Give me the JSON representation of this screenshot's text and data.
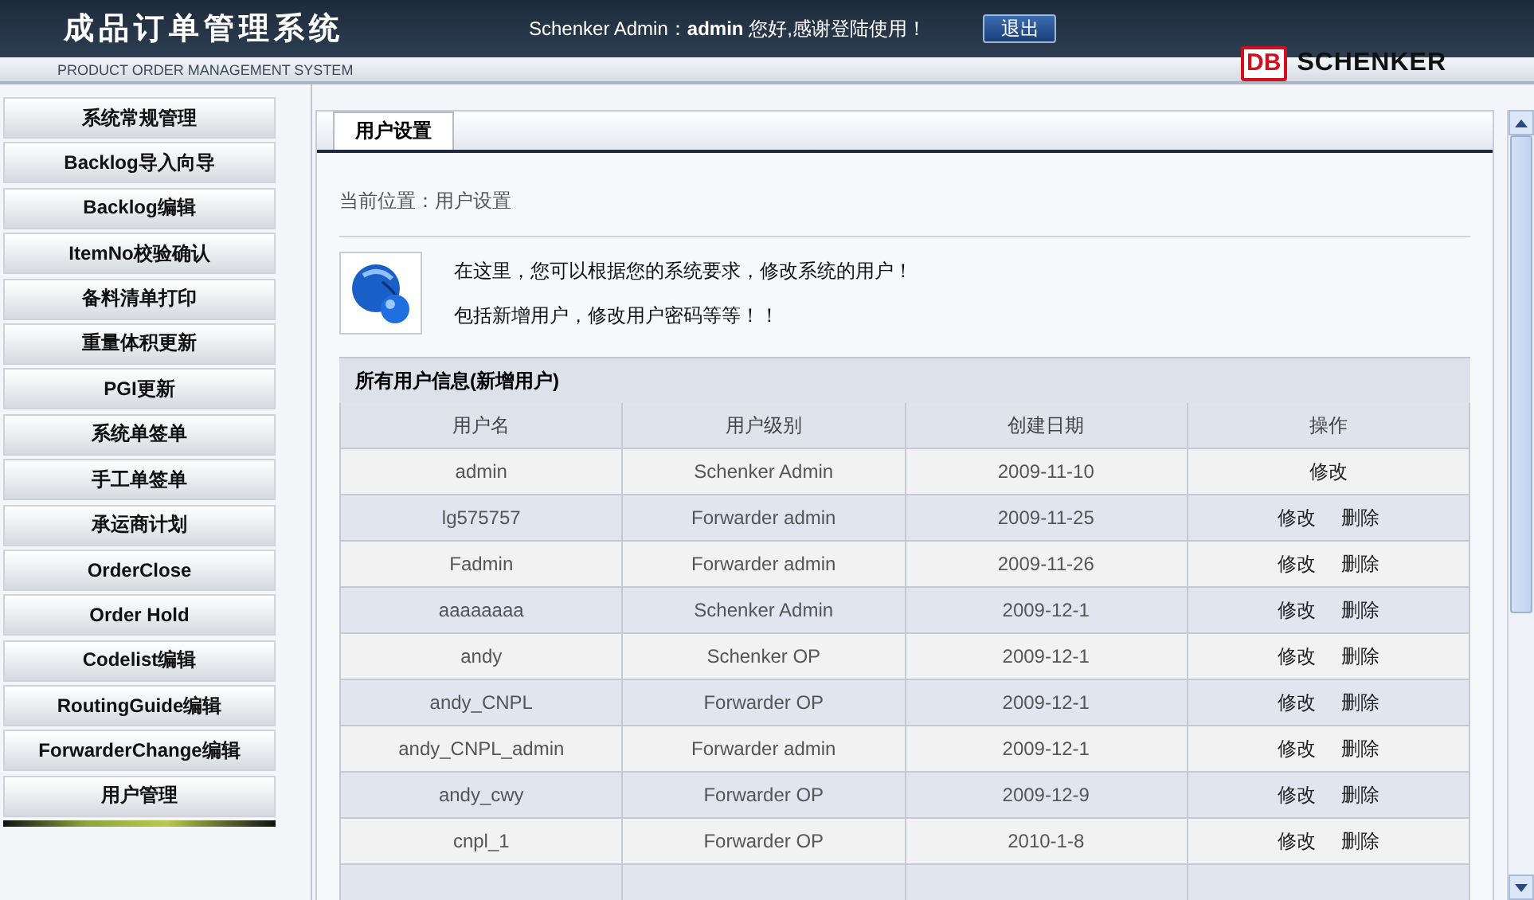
{
  "header": {
    "title": "成品订单管理系统",
    "subtitle": "PRODUCT ORDER MANAGEMENT SYSTEM",
    "greeting": "Schenker Admin：**admin** 您好,感谢登陆使用！",
    "logout": "退出",
    "logo_mark": "DB",
    "logo_text": "SCHENKER"
  },
  "sidebar": {
    "items": [
      {
        "label": "系统常规管理"
      },
      {
        "label": "Backlog导入向导"
      },
      {
        "label": "Backlog编辑"
      },
      {
        "label": "ItemNo校验确认"
      },
      {
        "label": "备料清单打印"
      },
      {
        "label": "重量体积更新"
      },
      {
        "label": "PGI更新"
      },
      {
        "label": "系统单签单"
      },
      {
        "label": "手工单签单"
      },
      {
        "label": "承运商计划"
      },
      {
        "label": "OrderClose"
      },
      {
        "label": "Order Hold"
      },
      {
        "label": "Codelist编辑"
      },
      {
        "label": "RoutingGuide编辑"
      },
      {
        "label": "ForwarderChange编辑"
      },
      {
        "label": "用户管理"
      }
    ]
  },
  "tab": {
    "label": "用户设置"
  },
  "breadcrumb": "当前位置：用户设置",
  "intro": [
    "在这里，您可以根据您的系统要求，修改系统的用户！",
    "包括新增用户，修改用户密码等等！！"
  ],
  "table": {
    "title": "所有用户信息(新增用户)",
    "columns": [
      "用户名",
      "用户级别",
      "创建日期",
      "操作"
    ],
    "rows": [
      {
        "name": "admin",
        "level": "Schenker Admin",
        "date": "2009-11-10",
        "actions": [
          "修改"
        ]
      },
      {
        "name": "lg575757",
        "level": "Forwarder admin",
        "date": "2009-11-25",
        "actions": [
          "修改",
          "删除"
        ]
      },
      {
        "name": "Fadmin",
        "level": "Forwarder admin",
        "date": "2009-11-26",
        "actions": [
          "修改",
          "删除"
        ]
      },
      {
        "name": "aaaaaaaa",
        "level": "Schenker Admin",
        "date": "2009-12-1",
        "actions": [
          "修改",
          "删除"
        ]
      },
      {
        "name": "andy",
        "level": "Schenker OP",
        "date": "2009-12-1",
        "actions": [
          "修改",
          "删除"
        ]
      },
      {
        "name": "andy_CNPL",
        "level": "Forwarder OP",
        "date": "2009-12-1",
        "actions": [
          "修改",
          "删除"
        ]
      },
      {
        "name": "andy_CNPL_admin",
        "level": "Forwarder admin",
        "date": "2009-12-1",
        "actions": [
          "修改",
          "删除"
        ]
      },
      {
        "name": "andy_cwy",
        "level": "Forwarder OP",
        "date": "2009-12-9",
        "actions": [
          "修改",
          "删除"
        ]
      },
      {
        "name": "cnpl_1",
        "level": "Forwarder OP",
        "date": "2010-1-8",
        "actions": [
          "修改",
          "删除"
        ]
      }
    ]
  }
}
